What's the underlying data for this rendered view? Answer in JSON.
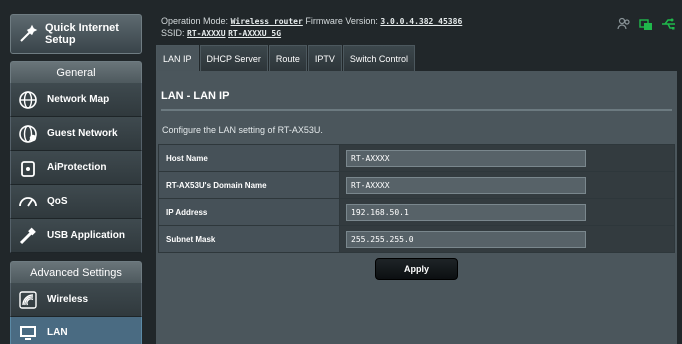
{
  "sidebar": {
    "quick_setup": "Quick Internet Setup",
    "general_head": "General",
    "general_items": [
      {
        "label": "Network Map",
        "icon": "globe-icon"
      },
      {
        "label": "Guest Network",
        "icon": "guest-globe-icon"
      },
      {
        "label": "AiProtection",
        "icon": "lock-icon"
      },
      {
        "label": "QoS",
        "icon": "speedometer-icon"
      },
      {
        "label": "USB Application",
        "icon": "usb-icon"
      }
    ],
    "advanced_head": "Advanced Settings",
    "advanced_items": [
      {
        "label": "Wireless",
        "icon": "wifi-icon"
      },
      {
        "label": "LAN",
        "icon": "monitor-icon",
        "active": true
      }
    ]
  },
  "header": {
    "op_mode_label": "Operation Mode:",
    "op_mode_value": "Wireless router",
    "fw_label": "Firmware Version:",
    "fw_value": "3.0.0.4.382_45386",
    "ssid_label": "SSID:",
    "ssid_1": "RT-AXXXU",
    "ssid_2": "RT-AXXXU_5G",
    "status_icons": [
      "users-icon",
      "network-icon",
      "usb-status-icon"
    ],
    "status_colors": {
      "users": "#8a9498",
      "network": "#1fb84b",
      "usb": "#1fb84b"
    }
  },
  "tabs": [
    {
      "label": "LAN IP",
      "active": true
    },
    {
      "label": "DHCP Server"
    },
    {
      "label": "Route"
    },
    {
      "label": "IPTV"
    },
    {
      "label": "Switch Control"
    }
  ],
  "main": {
    "title": "LAN - LAN IP",
    "description": "Configure the LAN setting of RT-AX53U.",
    "fields": [
      {
        "label": "Host Name",
        "value": "RT-AXXXX"
      },
      {
        "label": "RT-AX53U's Domain Name",
        "value": "RT-AXXXX"
      },
      {
        "label": "IP Address",
        "value": "192.168.50.1"
      },
      {
        "label": "Subnet Mask",
        "value": "255.255.255.0"
      }
    ],
    "apply_label": "Apply"
  }
}
